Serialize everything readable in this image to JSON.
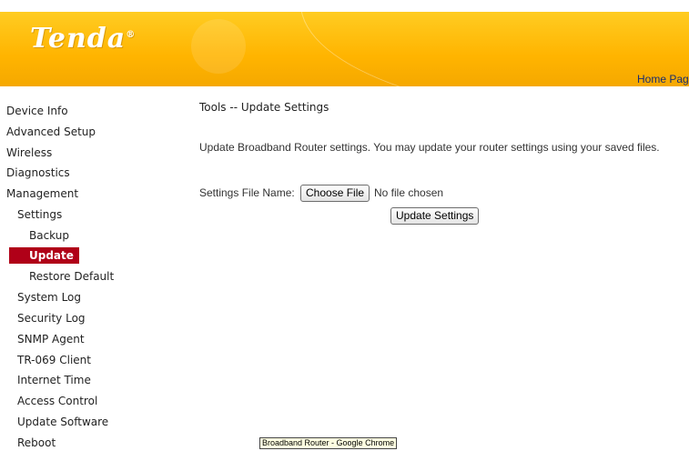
{
  "header": {
    "logo_text": "Tenda",
    "logo_mark": "®",
    "home_link": "Home Page"
  },
  "sidebar": {
    "items": [
      {
        "label": "Device Info"
      },
      {
        "label": "Advanced Setup"
      },
      {
        "label": "Wireless"
      },
      {
        "label": "Diagnostics"
      },
      {
        "label": "Management"
      },
      {
        "label": "Settings"
      },
      {
        "label": "Backup"
      },
      {
        "label": "Update"
      },
      {
        "label": "Restore Default"
      },
      {
        "label": "System Log"
      },
      {
        "label": "Security Log"
      },
      {
        "label": "SNMP Agent"
      },
      {
        "label": "TR-069 Client"
      },
      {
        "label": "Internet Time"
      },
      {
        "label": "Access Control"
      },
      {
        "label": "Update Software"
      },
      {
        "label": "Reboot"
      }
    ],
    "active_label": "Update",
    "active_color": "#b00018"
  },
  "main": {
    "title": "Tools -- Update Settings",
    "description": "Update Broadband Router settings. You may update your router settings using your saved files.",
    "file_label": "Settings File Name:",
    "choose_button": "Choose File",
    "no_file_text": "No file chosen",
    "update_button": "Update Settings"
  },
  "tooltip": {
    "text": "Broadband Router - Google Chrome"
  },
  "colors": {
    "header_accent": "#ffb400",
    "link": "#1a2e6e"
  }
}
